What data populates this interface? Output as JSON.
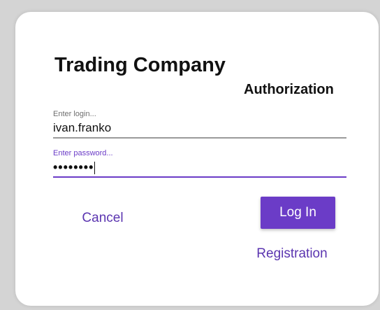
{
  "app": {
    "title": "Trading Company",
    "subtitle": "Authorization"
  },
  "login": {
    "placeholder": "Enter login...",
    "value": "ivan.franko"
  },
  "password": {
    "placeholder": "Enter password...",
    "masked_value": "••••••••"
  },
  "actions": {
    "cancel_label": "Cancel",
    "login_label": "Log In",
    "registration_label": "Registration"
  },
  "colors": {
    "accent": "#6b3cc7",
    "link": "#5b35b0",
    "background": "#d4d4d4",
    "card": "#ffffff"
  }
}
